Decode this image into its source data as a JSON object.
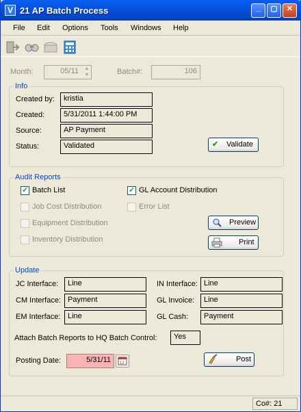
{
  "window": {
    "title": "21 AP Batch Process"
  },
  "menu": [
    "File",
    "Edit",
    "Options",
    "Tools",
    "Windows",
    "Help"
  ],
  "toolbar": [
    "exit-icon",
    "find-icon",
    "batch-icon",
    "calculator-icon"
  ],
  "header": {
    "month_label": "Month:",
    "month_value": "05/11",
    "batch_label": "Batch#:",
    "batch_value": "106"
  },
  "info": {
    "title": "Info",
    "created_by_label": "Created by:",
    "created_by": "kristia",
    "created_label": "Created:",
    "created": "5/31/2011 1:44:00 PM",
    "source_label": "Source:",
    "source": "AP Payment",
    "status_label": "Status:",
    "status": "Validated",
    "validate_btn": "Validate"
  },
  "audit": {
    "title": "Audit Reports",
    "batch_list": "Batch List",
    "gl_dist": "GL Account Distribution",
    "job_cost": "Job Cost Distribution",
    "error_list": "Error List",
    "equipment": "Equipment Distribution",
    "inventory": "Inventory Distribution",
    "preview_btn": "Preview",
    "print_btn": "Print"
  },
  "update": {
    "title": "Update",
    "jc_label": "JC Interface:",
    "jc": "Line",
    "in_label": "IN Interface:",
    "in": "Line",
    "cm_label": "CM Interface:",
    "cm": "Payment",
    "gl_inv_label": "GL Invoice:",
    "gl_inv": "Line",
    "em_label": "EM Interface:",
    "em": "Line",
    "gl_cash_label": "GL Cash:",
    "gl_cash": "Payment",
    "attach_label": "Attach Batch Reports to HQ Batch Control:",
    "attach": "Yes",
    "posting_label": "Posting Date:",
    "posting": "5/31/11",
    "post_btn": "Post"
  },
  "status": {
    "co": "Co#: 21"
  }
}
